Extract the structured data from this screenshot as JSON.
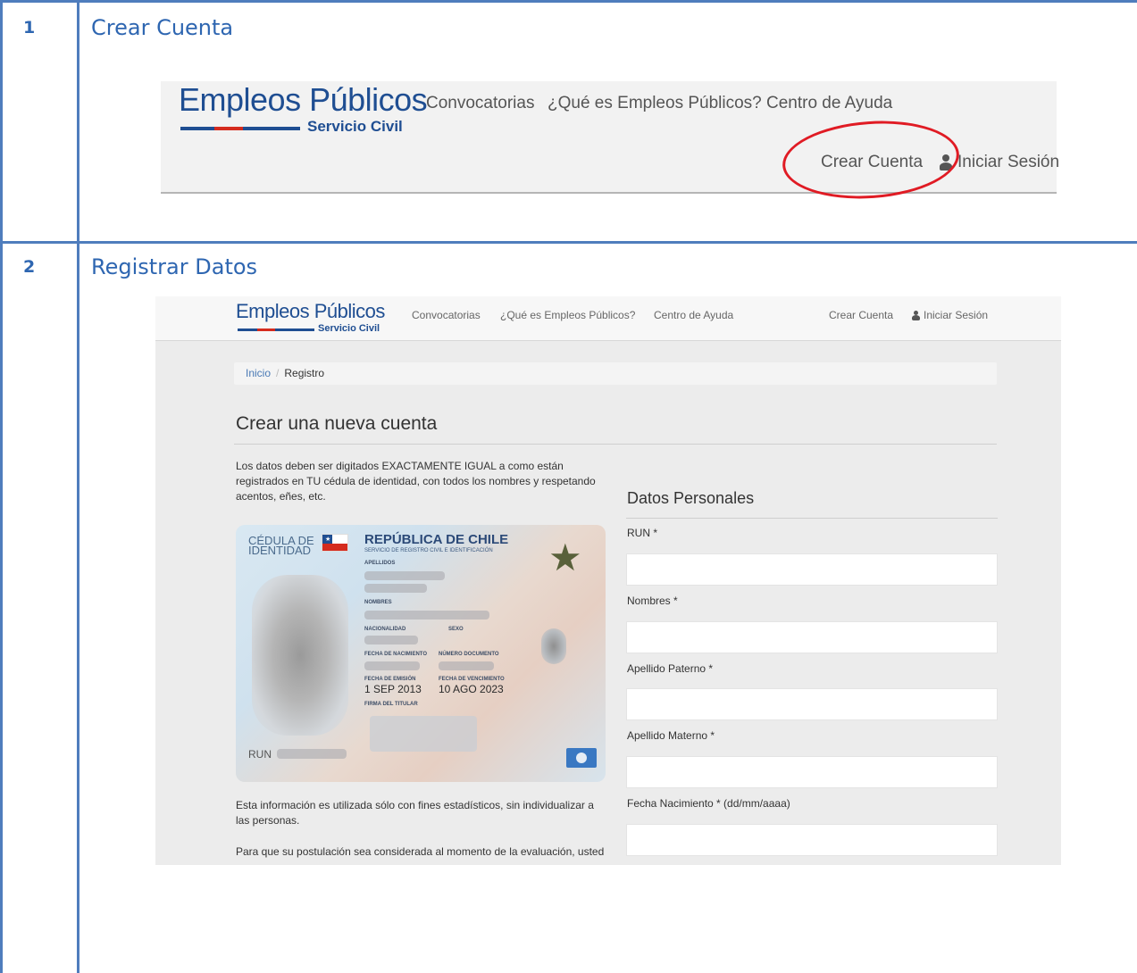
{
  "steps": [
    {
      "number": "1",
      "title": "Crear Cuenta"
    },
    {
      "number": "2",
      "title": "Registrar Datos"
    }
  ],
  "logo": {
    "main": "Empleos Públicos",
    "sub": "Servicio Civil"
  },
  "nav": {
    "items": [
      "Convocatorias",
      "¿Qué es Empleos Públicos?",
      "Centro de Ayuda"
    ],
    "create_account": "Crear Cuenta",
    "login": "Iniciar Sesión"
  },
  "breadcrumb": {
    "home": "Inicio",
    "separator": "/",
    "current": "Registro"
  },
  "page_title": "Crear una nueva cuenta",
  "intro_text": "Los datos deben ser digitados EXACTAMENTE IGUAL a como están registrados en TU cédula de identidad, con todos los nombres y respetando acentos, eñes, etc.",
  "id_card": {
    "doc_type_line1": "CÉDULA DE",
    "doc_type_line2": "IDENTIDAD",
    "country": "REPÚBLICA DE CHILE",
    "agency": "SERVICIO DE REGISTRO CIVIL E IDENTIFICACIÓN",
    "label_apellidos": "APELLIDOS",
    "label_nombres": "NOMBRES",
    "label_nacionalidad": "NACIONALIDAD",
    "label_sexo": "SEXO",
    "label_fecha_nacimiento": "FECHA DE NACIMIENTO",
    "label_numero_documento": "NÚMERO DOCUMENTO",
    "label_fecha_emision": "FECHA DE EMISIÓN",
    "label_fecha_vencimiento": "FECHA DE VENCIMIENTO",
    "fecha_emision": "1 SEP 2013",
    "fecha_vencimiento": "10 AGO 2023",
    "label_firma": "FIRMA DEL TITULAR",
    "label_run": "RUN"
  },
  "stats_text": "Esta información es utilizada sólo con fines estadísticos, sin individualizar a las personas.",
  "evaluation_text": "Para que su postulación sea considerada al momento de la evaluación, usted",
  "form": {
    "heading": "Datos Personales",
    "fields": [
      {
        "label": "RUN *",
        "value": ""
      },
      {
        "label": "Nombres *",
        "value": ""
      },
      {
        "label": "Apellido Paterno *",
        "value": ""
      },
      {
        "label": "Apellido Materno *",
        "value": ""
      },
      {
        "label": "Fecha Nacimiento * (dd/mm/aaaa)",
        "value": ""
      }
    ]
  },
  "colors": {
    "table_border": "#4f7dbd",
    "step_text": "#2e66b1",
    "logo_blue": "#1f4e92",
    "logo_red": "#d52b1e",
    "highlight_circle": "#e01b24"
  },
  "icons": [
    "user-icon",
    "star-seal-icon",
    "chile-flag-icon",
    "chip-icon"
  ]
}
